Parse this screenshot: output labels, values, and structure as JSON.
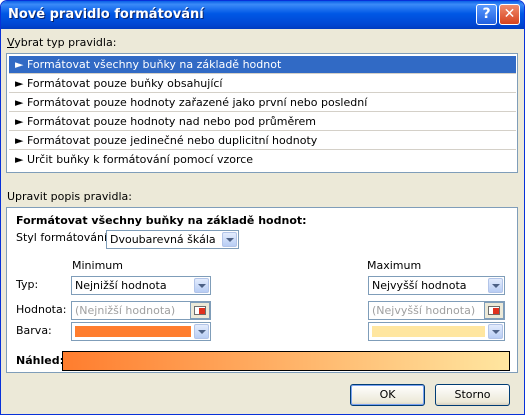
{
  "window": {
    "title": "Nové pravidlo formátování",
    "help_icon": "?",
    "close_icon": "✕"
  },
  "rule_type": {
    "label": "Vybrat typ pravidla:",
    "items": [
      "► Formátovat všechny buňky na základě hodnot",
      "► Formátovat pouze buňky obsahující",
      "► Formátovat pouze hodnoty zařazené jako první nebo poslední",
      "► Formátovat pouze hodnoty nad nebo pod průměrem",
      "► Formátovat pouze jedinečné nebo duplicitní hodnoty",
      "► Určit buňky k formátování pomocí vzorce"
    ],
    "selected_index": 0
  },
  "description": {
    "label": "Upravit popis pravidla:",
    "heading": "Formátovat všechny buňky na základě hodnot:",
    "style_label": "Styl formátování:",
    "style_value": "Dvoubarevná škála",
    "min_header": "Minimum",
    "max_header": "Maximum",
    "type_label": "Typ:",
    "value_label": "Hodnota:",
    "color_label": "Barva:",
    "min_type": "Nejnižší hodnota",
    "max_type": "Nejvyšší hodnota",
    "min_value_placeholder": "(Nejnižší hodnota)",
    "max_value_placeholder": "(Nejvyšší hodnota)",
    "min_color": "#ff7d2e",
    "max_color": "#ffe6a0",
    "preview_label": "Náhled:"
  },
  "buttons": {
    "ok": "OK",
    "cancel": "Storno"
  }
}
